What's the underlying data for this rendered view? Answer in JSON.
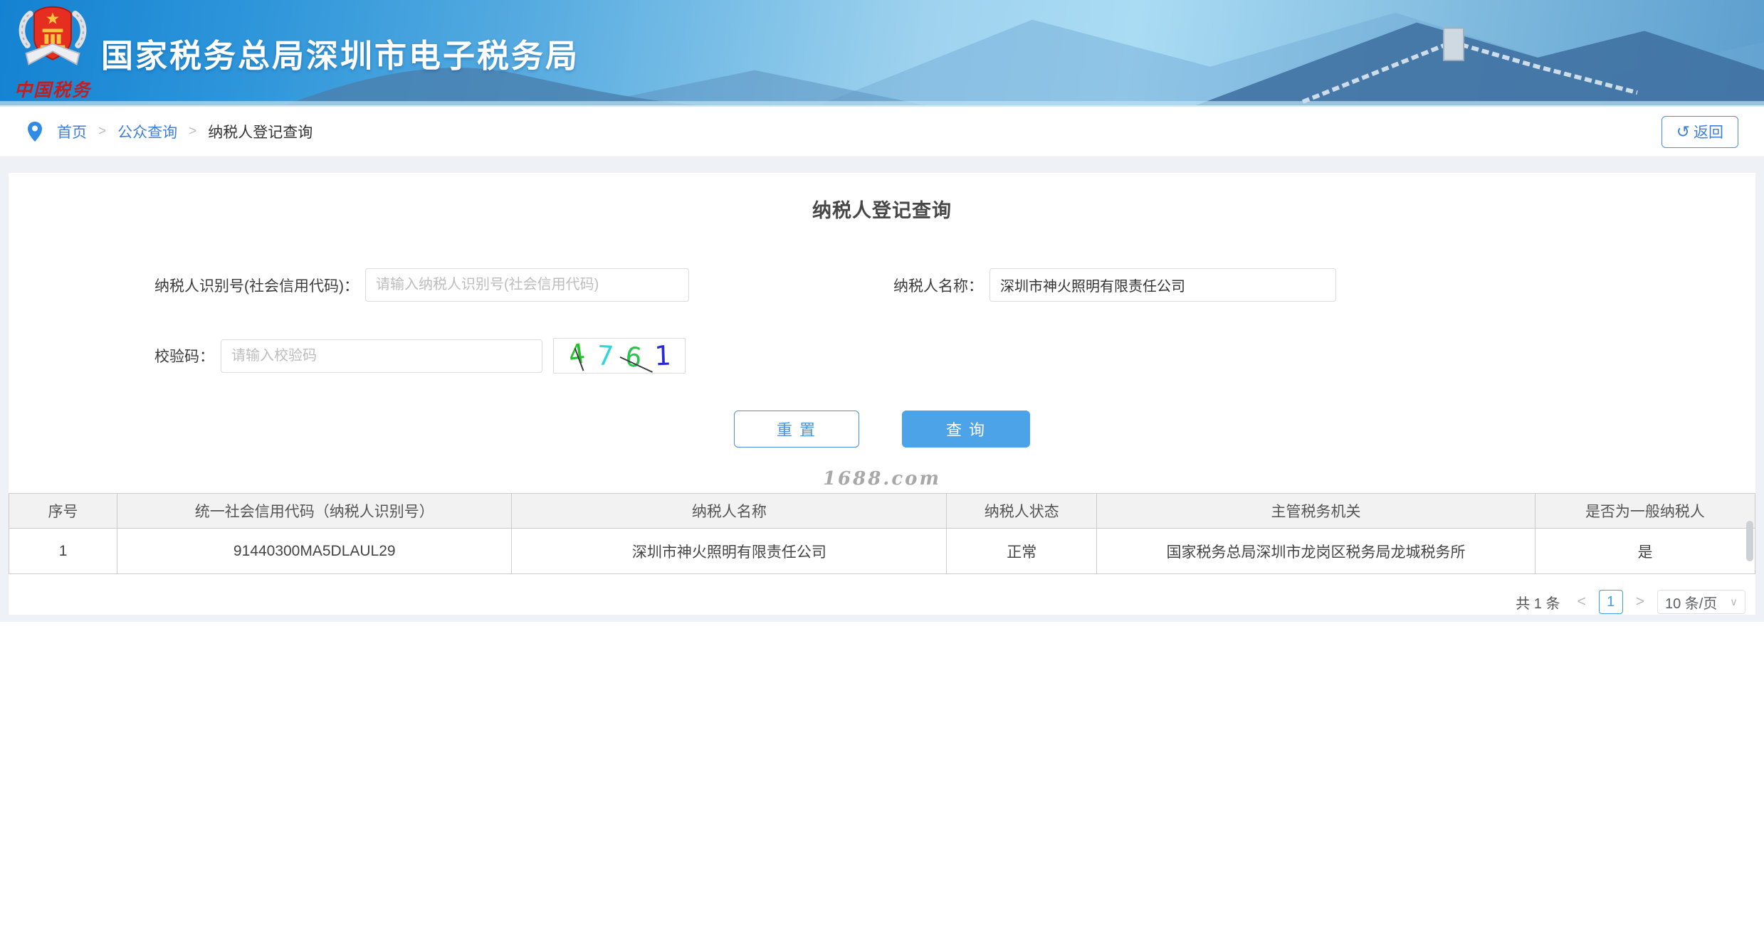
{
  "banner": {
    "org_name": "国家税务总局深圳市电子税务局",
    "logo_caption": "中国税务"
  },
  "breadcrumb": {
    "home": "首页",
    "section": "公众查询",
    "current": "纳税人登记查询",
    "separator": ">",
    "back_icon": "↺",
    "back_label": "返回"
  },
  "page": {
    "title": "纳税人登记查询"
  },
  "form": {
    "taxpayer_id": {
      "label": "纳税人识别号(社会信用代码)：",
      "placeholder": "请输入纳税人识别号(社会信用代码)",
      "value": ""
    },
    "taxpayer_name": {
      "label": "纳税人名称：",
      "value": "深圳市神火照明有限责任公司"
    },
    "captcha": {
      "label": "校验码：",
      "placeholder": "请输入校验码",
      "value": "",
      "code": "4761",
      "chars": [
        {
          "char": "4",
          "color": "#22c32a"
        },
        {
          "char": "7",
          "color": "#2fd6de"
        },
        {
          "char": "6",
          "color": "#2cc24f"
        },
        {
          "char": "1",
          "color": "#2a28d8"
        }
      ]
    },
    "buttons": {
      "reset": "重 置",
      "query": "查 询"
    }
  },
  "watermark": "1688.com",
  "table": {
    "columns": [
      "序号",
      "统一社会信用代码（纳税人识别号）",
      "纳税人名称",
      "纳税人状态",
      "主管税务机关",
      "是否为一般纳税人"
    ],
    "rows": [
      [
        "1",
        "91440300MA5DLAUL29",
        "深圳市神火照明有限责任公司",
        "正常",
        "国家税务总局深圳市龙岗区税务局龙城税务所",
        "是"
      ]
    ]
  },
  "pagination": {
    "total_text": "共 1 条",
    "prev": "<",
    "current_page": "1",
    "next": ">",
    "page_size": "10 条/页",
    "chevron": "∨"
  },
  "colors": {
    "banner_blue": "#1886d6",
    "link_blue": "#3e7fdb",
    "primary_button_blue": "#4da3e8",
    "pagination_active_blue": "#3aa0e8",
    "table_header_bg": "#f2f2f2",
    "status_normal_text": "#444444"
  }
}
